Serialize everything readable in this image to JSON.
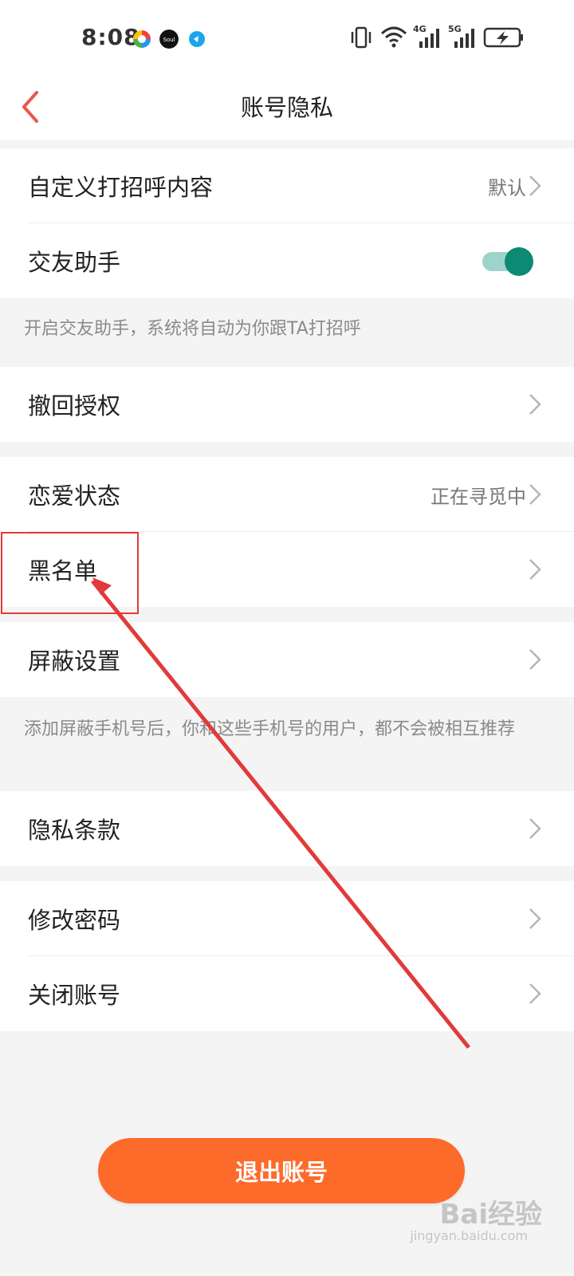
{
  "status_bar": {
    "time": "8:08",
    "network_labels": [
      "4G",
      "5G"
    ],
    "icons": [
      "color-circle-app-icon",
      "soul-app-icon",
      "blue-app-icon",
      "vibrate-icon",
      "wifi-icon",
      "signal-4g-icon",
      "signal-5g-icon",
      "battery-charging-icon"
    ]
  },
  "header": {
    "title": "账号隐私",
    "back_icon": "back-chevron-icon"
  },
  "rows": {
    "greeting": {
      "label": "自定义打招呼内容",
      "value": "默认"
    },
    "assistant": {
      "label": "交友助手",
      "toggle_on": true
    },
    "assistant_note": "开启交友助手，系统将自动为你跟TA打招呼",
    "revoke": {
      "label": "撤回授权"
    },
    "relationship": {
      "label": "恋爱状态",
      "value": "正在寻觅中"
    },
    "blacklist": {
      "label": "黑名单"
    },
    "block": {
      "label": "屏蔽设置"
    },
    "block_note": "添加屏蔽手机号后，你和这些手机号的用户，都不会被相互推荐",
    "privacy": {
      "label": "隐私条款"
    },
    "password": {
      "label": "修改密码"
    },
    "close_account": {
      "label": "关闭账号"
    }
  },
  "logout_label": "退出账号",
  "watermark": {
    "main": "Bai经验",
    "sub": "jingyan.baidu.com"
  },
  "colors": {
    "accent": "#fd6b2a",
    "toggle_on": "#0d8a74",
    "toggle_track": "#9ed3c9",
    "back": "#e8584f",
    "annotation": "#e23a3a"
  }
}
